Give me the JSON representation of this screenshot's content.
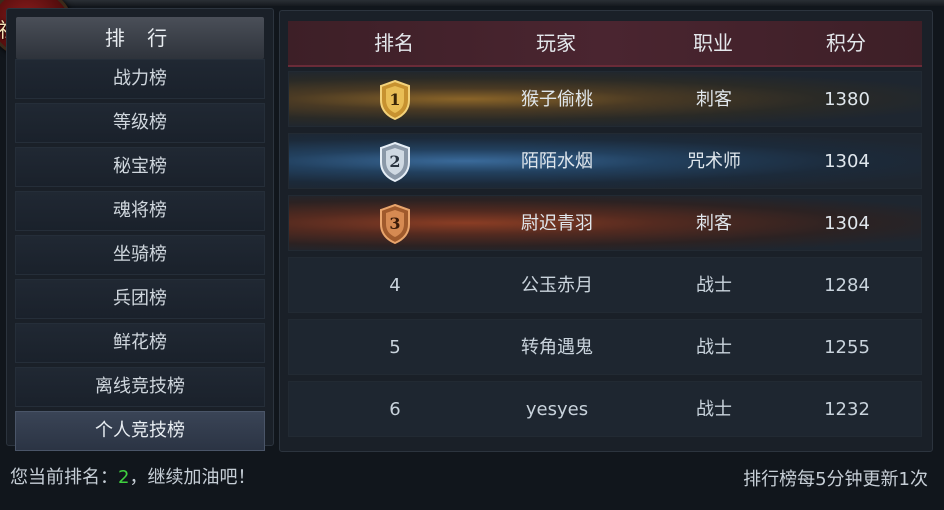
{
  "badge": {
    "label": "社交"
  },
  "sidebar": {
    "title": "排 行",
    "items": [
      {
        "label": "战力榜"
      },
      {
        "label": "等级榜"
      },
      {
        "label": "秘宝榜"
      },
      {
        "label": "魂将榜"
      },
      {
        "label": "坐骑榜"
      },
      {
        "label": "兵团榜"
      },
      {
        "label": "鲜花榜"
      },
      {
        "label": "离线竞技榜"
      },
      {
        "label": "个人竞技榜",
        "active": true
      }
    ]
  },
  "table": {
    "columns": [
      "排名",
      "玩家",
      "职业",
      "积分"
    ],
    "rows": [
      {
        "rank": "1",
        "player": "猴子偷桃",
        "class": "刺客",
        "score": "1380",
        "medal": "gold-medal-icon"
      },
      {
        "rank": "2",
        "player": "陌陌水烟",
        "class": "咒术师",
        "score": "1304",
        "medal": "silver-medal-icon"
      },
      {
        "rank": "3",
        "player": "尉迟青羽",
        "class": "刺客",
        "score": "1304",
        "medal": "bronze-medal-icon"
      },
      {
        "rank": "4",
        "player": "公玉赤月",
        "class": "战士",
        "score": "1284"
      },
      {
        "rank": "5",
        "player": "转角遇鬼",
        "class": "战士",
        "score": "1255"
      },
      {
        "rank": "6",
        "player": "yesyes",
        "class": "战士",
        "score": "1232"
      }
    ]
  },
  "footer": {
    "rank_prefix": "您当前排名：",
    "rank_value": "2",
    "rank_suffix": "，继续加油吧！",
    "update_note": "排行榜每5分钟更新1次"
  },
  "colors": {
    "gold": "#d9a93a",
    "silver": "#c9d3dc",
    "bronze": "#c8703a",
    "highlight": "#3fd13f"
  }
}
